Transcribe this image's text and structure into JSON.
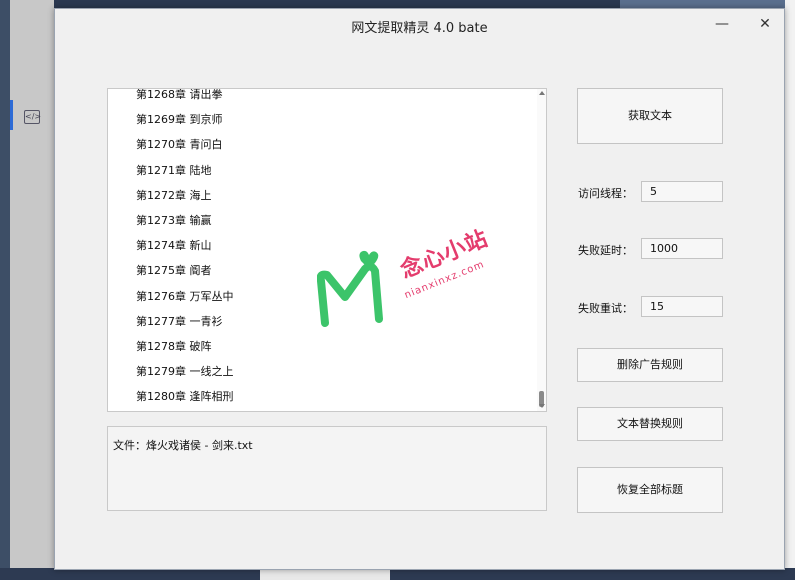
{
  "window": {
    "title": "网文提取精灵 4.0 bate",
    "minimize_glyph": "—",
    "close_glyph": "✕"
  },
  "chapters": [
    "第1268章 请出拳",
    "第1269章 到京师",
    "第1270章 青问白",
    "第1271章 陆地",
    "第1272章 海上",
    "第1273章 输赢",
    "第1274章 新山",
    "第1275章 阍者",
    "第1276章 万军丛中",
    "第1277章 一青衫",
    "第1278章 破阵",
    "第1279章 一线之上",
    "第1280章 逢阵相刑"
  ],
  "log": {
    "file_line": "文件：烽火戏诸侯 - 剑来.txt"
  },
  "buttons": {
    "get_text": "获取文本",
    "remove_ad_rules": "删除广告规则",
    "text_replace_rules": "文本替换规则",
    "restore_titles": "恢复全部标题"
  },
  "settings": {
    "threads_label": "访问线程：",
    "threads_value": "5",
    "delay_label": "失败延时：",
    "delay_value": "1000",
    "retry_label": "失败重试：",
    "retry_value": "15"
  },
  "watermark": {
    "cn": "念心小站",
    "en": "nianxinxz.com",
    "icon": "heart-logo-icon",
    "color": "#e43c6d",
    "accent": "#3cc46a"
  },
  "side_icon_glyph": "</>"
}
